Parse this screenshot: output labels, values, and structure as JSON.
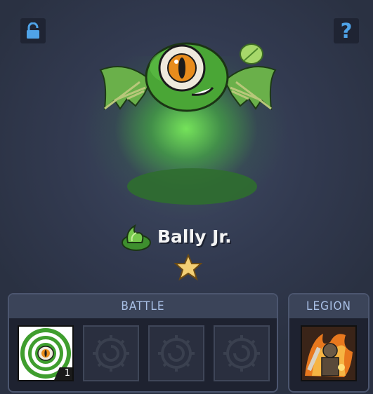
{
  "top_bar": {
    "lock_icon": "padlock-open-icon",
    "help_label": "?"
  },
  "creature": {
    "name": "Bally Jr.",
    "element_icon": "nature-flame-icon",
    "stars": 1,
    "accent_color": "#6fd94e"
  },
  "battle": {
    "title": "BATTLE",
    "slots": [
      {
        "state": "filled",
        "icon": "hypno-eye-ability-icon",
        "level": "1"
      },
      {
        "state": "empty",
        "icon": "swirl-emblem-icon"
      },
      {
        "state": "empty",
        "icon": "swirl-emblem-icon"
      },
      {
        "state": "empty",
        "icon": "swirl-emblem-icon"
      }
    ]
  },
  "legion": {
    "title": "LEGION",
    "slot_icon": "fire-warrior-portrait-icon"
  }
}
